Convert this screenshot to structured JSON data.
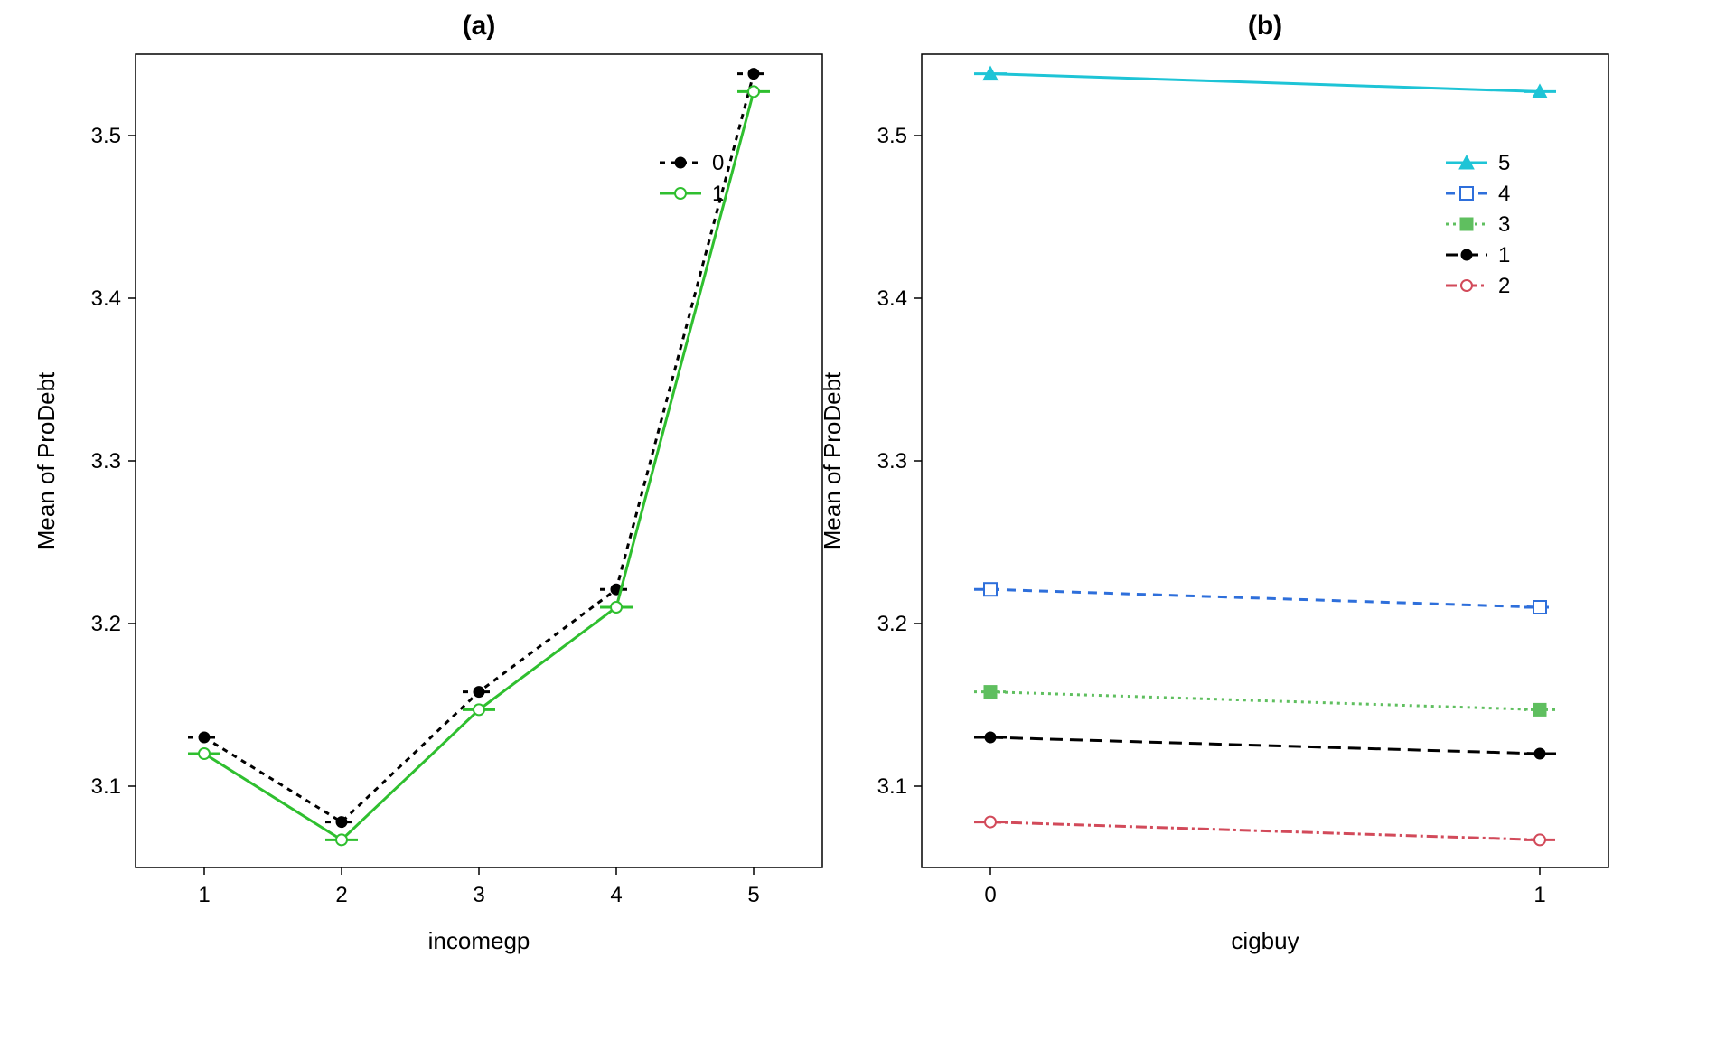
{
  "chart_data": [
    {
      "type": "line",
      "title": "(a)",
      "xlabel": "incomegp",
      "ylabel": "Mean of ProDebt",
      "ylim": [
        3.05,
        3.55
      ],
      "categories": [
        "1",
        "2",
        "3",
        "4",
        "5"
      ],
      "series": [
        {
          "name": "0",
          "values": [
            3.13,
            3.078,
            3.158,
            3.221,
            3.538
          ],
          "color": "#000000",
          "marker": "filled-circle",
          "dash": "6,6"
        },
        {
          "name": "1",
          "values": [
            3.12,
            3.067,
            3.147,
            3.21,
            3.527
          ],
          "color": "#2fbf2f",
          "marker": "open-circle",
          "dash": ""
        }
      ],
      "legend": {
        "items": [
          "0",
          "1"
        ]
      }
    },
    {
      "type": "line",
      "title": "(b)",
      "xlabel": "cigbuy",
      "ylabel": "Mean of ProDebt",
      "ylim": [
        3.05,
        3.55
      ],
      "categories": [
        "0",
        "1"
      ],
      "series": [
        {
          "name": "5",
          "values": [
            3.538,
            3.527
          ],
          "color": "#1ec4d6",
          "marker": "filled-triangle",
          "dash": ""
        },
        {
          "name": "4",
          "values": [
            3.221,
            3.21
          ],
          "color": "#2e6fdb",
          "marker": "open-square",
          "dash": "10,8"
        },
        {
          "name": "3",
          "values": [
            3.158,
            3.147
          ],
          "color": "#5fbf5f",
          "marker": "filled-square",
          "dash": "3,5"
        },
        {
          "name": "1",
          "values": [
            3.13,
            3.12
          ],
          "color": "#000000",
          "marker": "filled-circle",
          "dash": "14,8"
        },
        {
          "name": "2",
          "values": [
            3.078,
            3.067
          ],
          "color": "#d24a5a",
          "marker": "open-circle",
          "dash": "12,4,3,4"
        }
      ],
      "legend": {
        "items": [
          "5",
          "4",
          "3",
          "1",
          "2"
        ]
      }
    }
  ],
  "ticks_y": [
    "3.1",
    "3.2",
    "3.3",
    "3.4",
    "3.5"
  ]
}
